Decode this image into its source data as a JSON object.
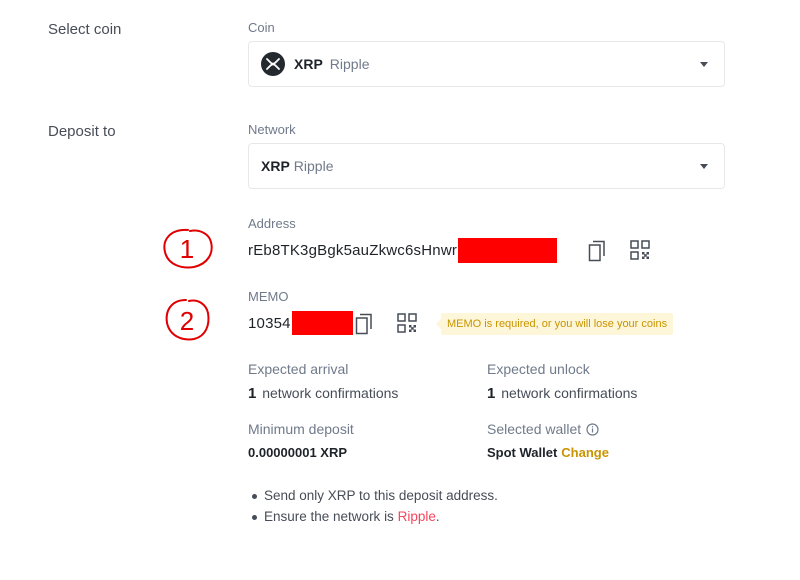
{
  "select_coin": {
    "section_label": "Select coin",
    "field_label": "Coin",
    "symbol": "XRP",
    "name": "Ripple"
  },
  "deposit_to": {
    "section_label": "Deposit to",
    "network_label": "Network",
    "network_symbol": "XRP",
    "network_name": "Ripple"
  },
  "address": {
    "label": "Address",
    "value_visible": "rEb8TK3gBgk5auZkwc6sHnwr",
    "value_redacted": true
  },
  "memo": {
    "label": "MEMO",
    "value_visible": "10354",
    "value_redacted": true,
    "warning": "MEMO is required, or you will lose your coins"
  },
  "info": {
    "expected_arrival_label": "Expected arrival",
    "expected_arrival_count": "1",
    "expected_arrival_unit": "network confirmations",
    "expected_unlock_label": "Expected unlock",
    "expected_unlock_count": "1",
    "expected_unlock_unit": "network confirmations",
    "minimum_deposit_label": "Minimum deposit",
    "minimum_deposit_value": "0.00000001 XRP",
    "selected_wallet_label": "Selected wallet",
    "selected_wallet_value": "Spot Wallet",
    "change_link": "Change"
  },
  "notes": {
    "note1": "Send only XRP to this deposit address.",
    "note2_prefix": "Ensure the network is ",
    "note2_network": "Ripple",
    "note2_suffix": "."
  },
  "annotations": [
    "1",
    "2"
  ],
  "icons": {
    "coin_logo": "xrp-logo-icon",
    "caret": "caret-down-icon",
    "copy": "copy-icon",
    "qr": "qr-code-icon",
    "help": "info-circle-icon"
  },
  "colors": {
    "accent": "#c99400",
    "warning_bg": "#fdf6d8",
    "network_link": "#f6465d",
    "redaction": "#ff0000",
    "annotation": "#e00000"
  }
}
